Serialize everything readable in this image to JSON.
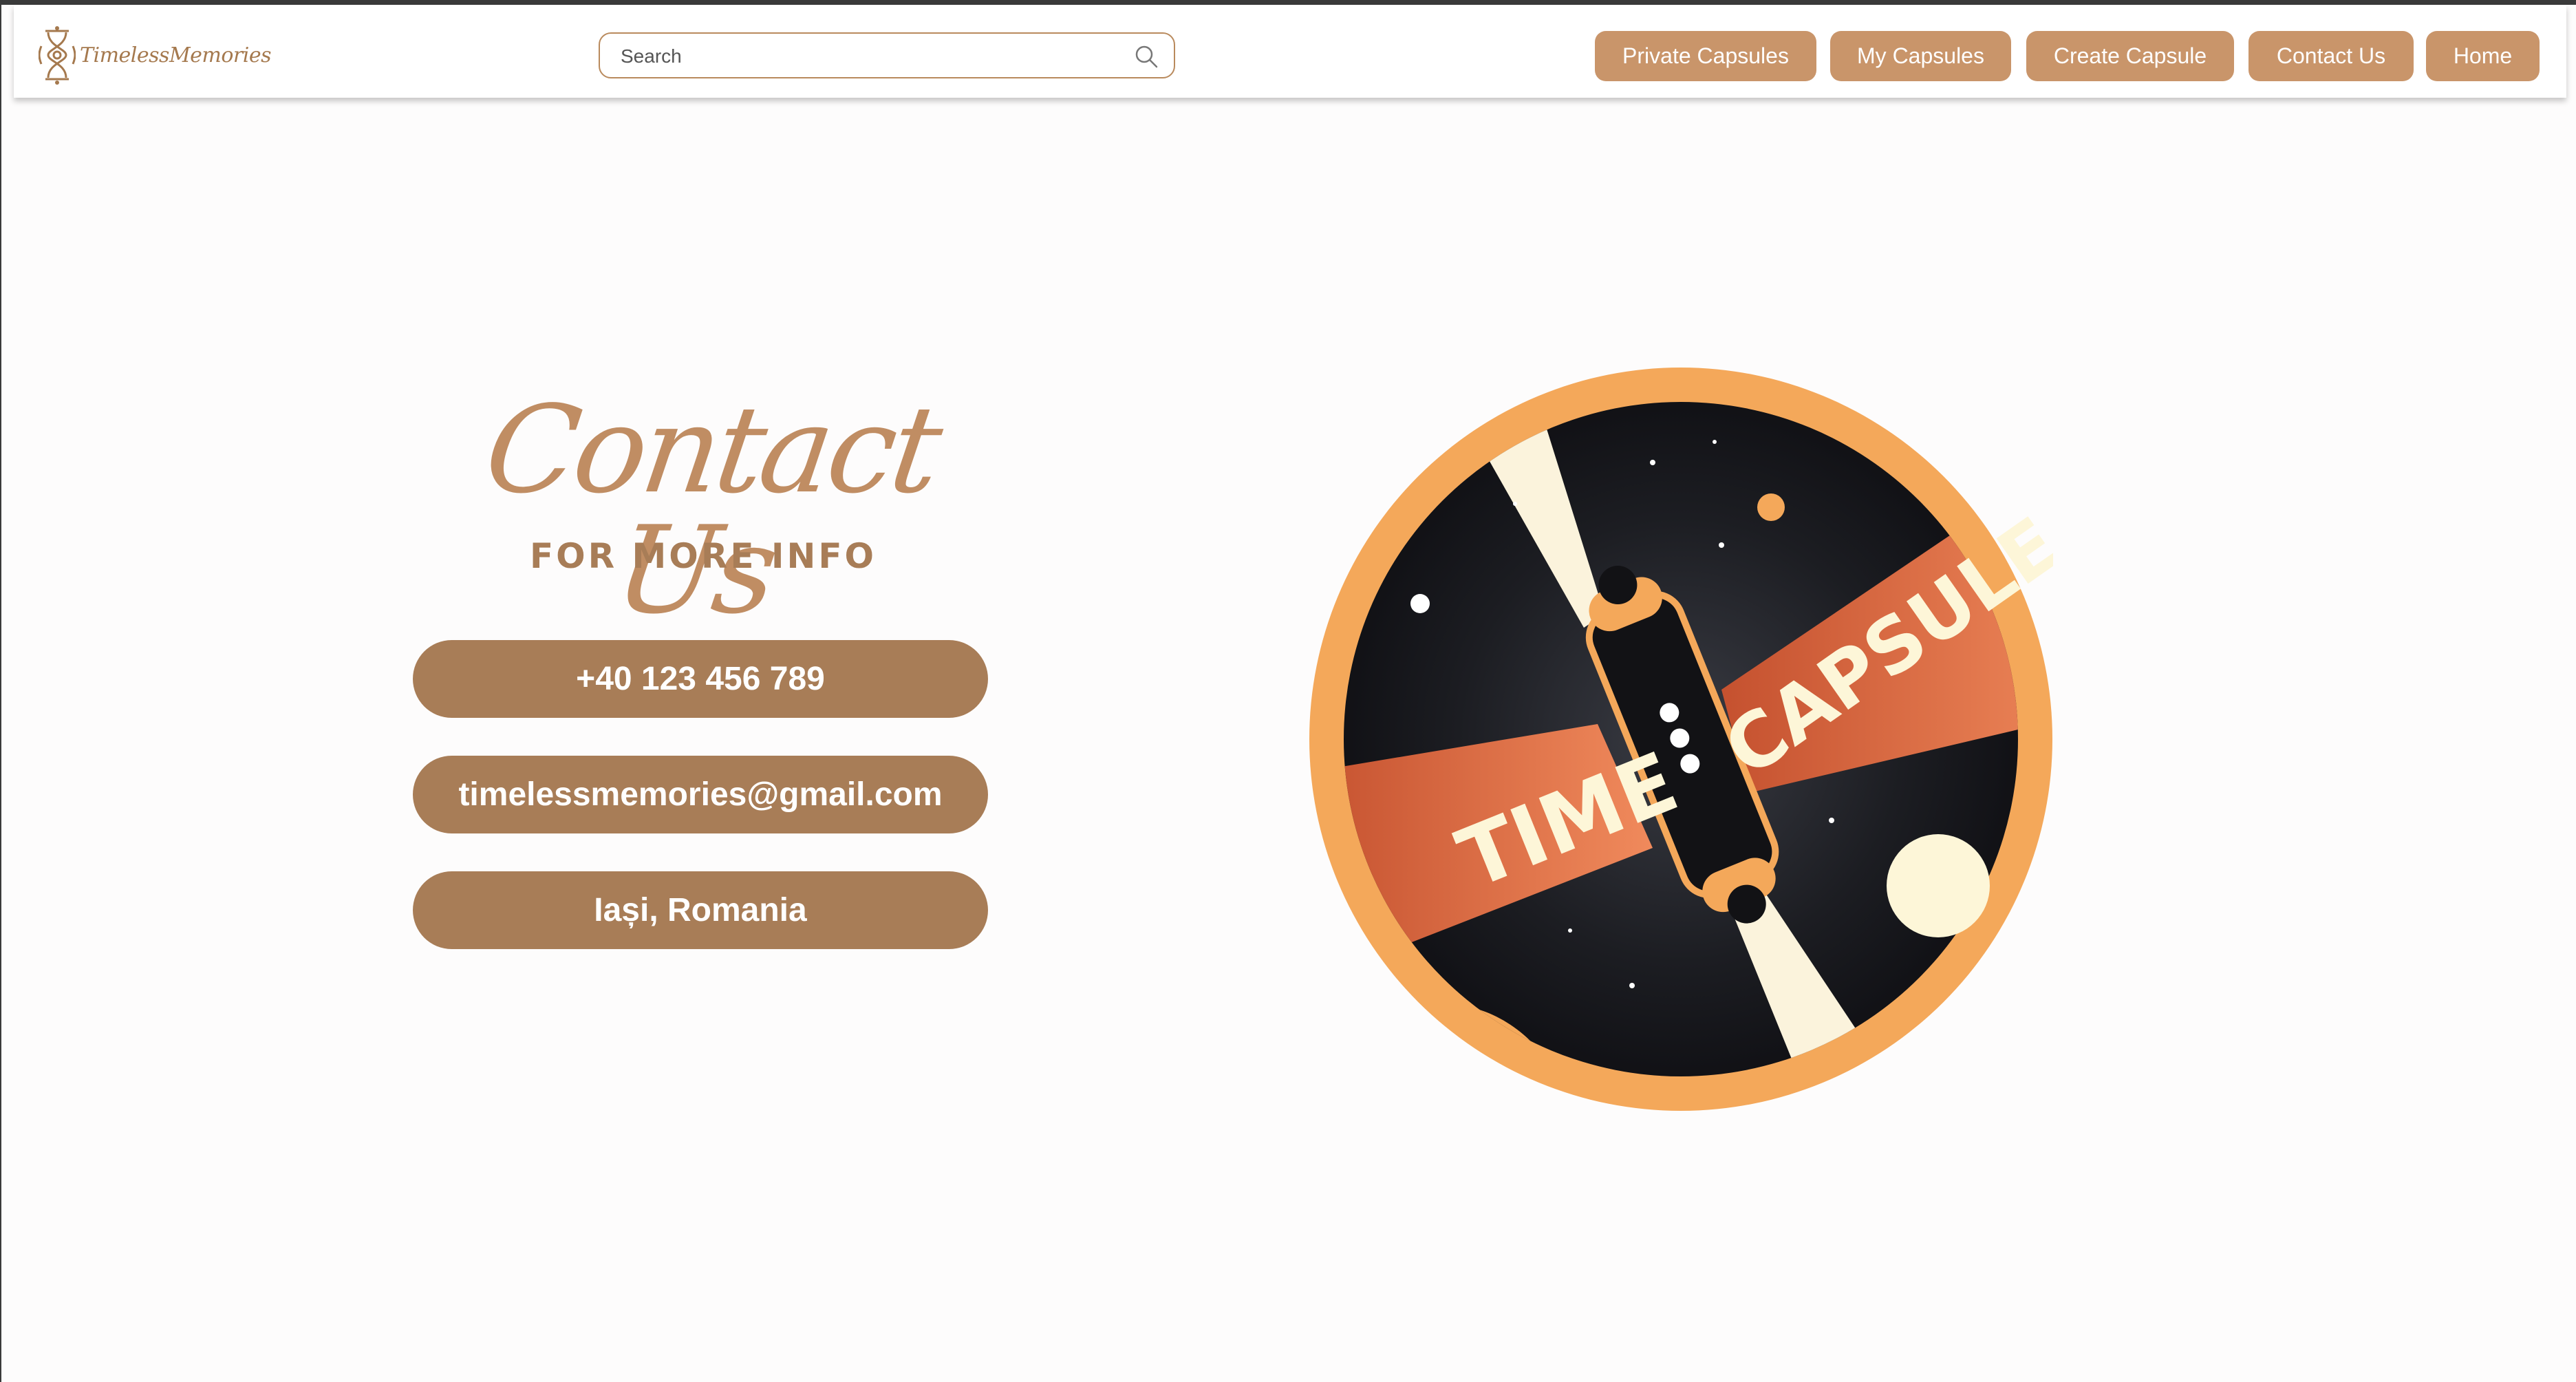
{
  "header": {
    "logo_text": "TimelessMemories",
    "search_placeholder": "Search",
    "nav": [
      {
        "label": "Private Capsules"
      },
      {
        "label": "My Capsules"
      },
      {
        "label": "Create Capsule"
      },
      {
        "label": "Contact Us"
      },
      {
        "label": "Home"
      }
    ]
  },
  "contact": {
    "title": "Contact Us",
    "subtitle": "FOR MORE INFO",
    "phone": "+40 123 456 789",
    "email": "timelessmemories@gmail.com",
    "location": "Iași, Romania"
  },
  "illustration": {
    "word_left": "TIME",
    "word_right": "CAPSULE"
  },
  "colors": {
    "nav_button": "#c9956a",
    "pill": "#a87d57",
    "accent_text": "#a87d57",
    "badge_ring": "#f4a85a",
    "badge_space": "#141418",
    "banner": "#e8744a"
  }
}
